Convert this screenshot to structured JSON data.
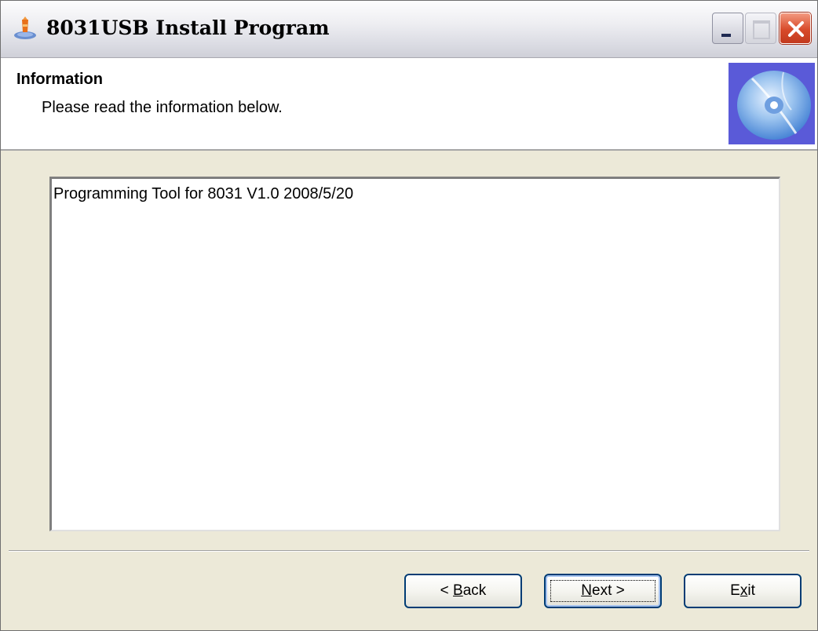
{
  "window": {
    "title": "8031USB Install Program"
  },
  "header": {
    "title": "Information",
    "subtitle": "Please read the information below."
  },
  "info": {
    "text": "Programming Tool for 8031 V1.0 2008/5/20"
  },
  "buttons": {
    "back": {
      "pre": "< ",
      "accel": "B",
      "post": "ack"
    },
    "next": {
      "pre": "",
      "accel": "N",
      "post": "ext >"
    },
    "exit": {
      "pre": "E",
      "accel": "x",
      "post": "it"
    }
  },
  "colors": {
    "header_graphic_bg": "#5a5ad8",
    "close_button": "#d84a2a",
    "button_border": "#003c74"
  },
  "icons": {
    "app": "installer-icon",
    "minimize": "minimize-icon",
    "maximize": "maximize-icon",
    "close": "close-icon",
    "header": "cd-disc-icon"
  }
}
